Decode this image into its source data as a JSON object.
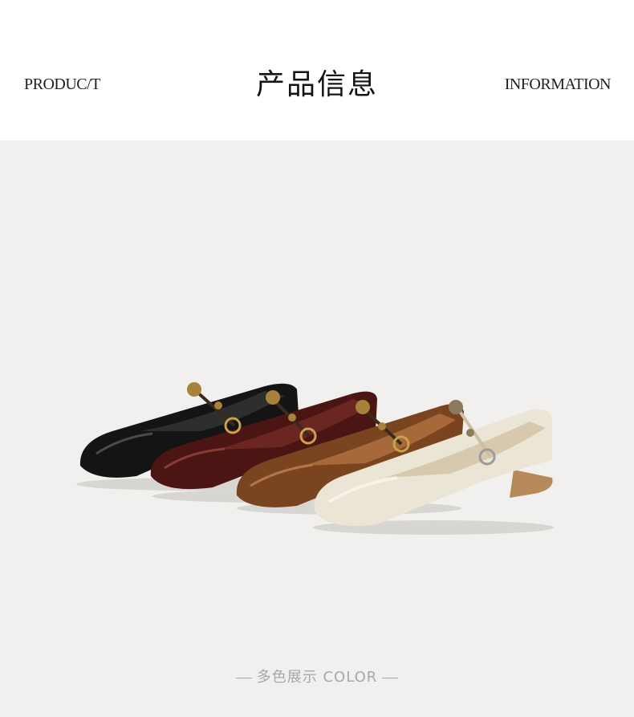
{
  "header": {
    "left_label": "PRODUC/T",
    "title": "产品信息",
    "right_label": "INFORMATION"
  },
  "product_photo": {
    "shoes": [
      {
        "color": "#141414",
        "name": "black"
      },
      {
        "color": "#4a1512",
        "name": "burgundy"
      },
      {
        "color": "#7a4420",
        "name": "brown"
      },
      {
        "color": "#ebe5d6",
        "name": "cream"
      }
    ],
    "hardware_color": "#a8823a"
  },
  "caption": {
    "text": "多色展示 COLOR"
  }
}
